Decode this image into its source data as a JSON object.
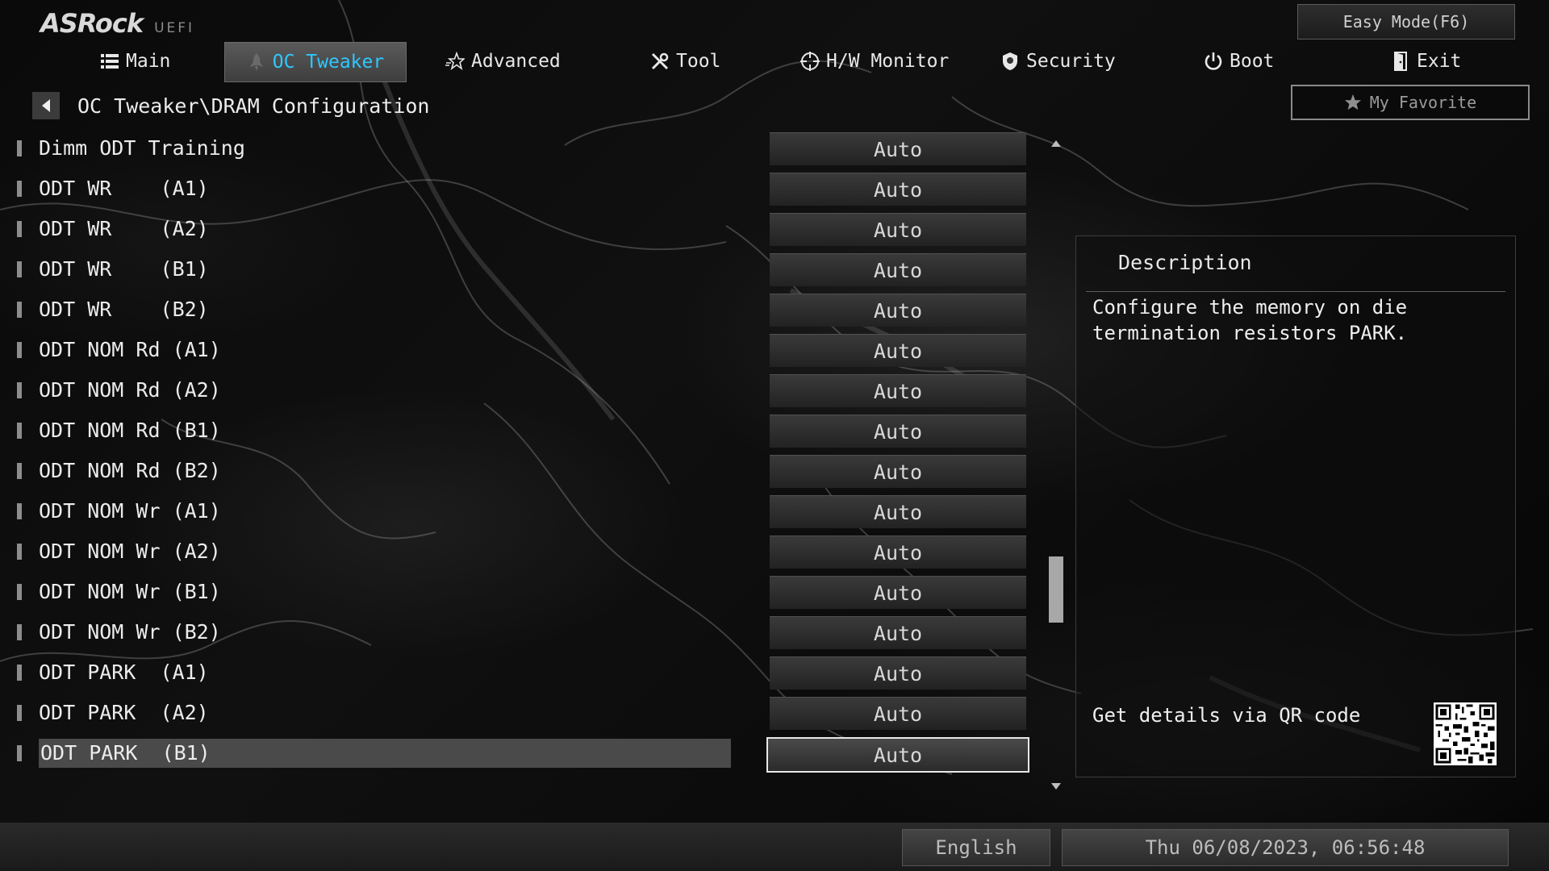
{
  "header": {
    "logo_main": "ASRock",
    "logo_sub": "UEFI",
    "easy_mode_label": "Easy Mode(F6)",
    "favorite_label": "My Favorite",
    "favorite_icon": "star-icon"
  },
  "nav": {
    "tabs": [
      {
        "label": "Main",
        "icon": "list-icon",
        "active": false
      },
      {
        "label": "OC Tweaker",
        "icon": "rocket-icon",
        "active": true
      },
      {
        "label": "Advanced",
        "icon": "star-icon",
        "active": false
      },
      {
        "label": "Tool",
        "icon": "tools-icon",
        "active": false
      },
      {
        "label": "H/W Monitor",
        "icon": "crosshair-icon",
        "active": false
      },
      {
        "label": "Security",
        "icon": "shield-icon",
        "active": false
      },
      {
        "label": "Boot",
        "icon": "power-icon",
        "active": false
      },
      {
        "label": "Exit",
        "icon": "exit-door-icon",
        "active": false
      }
    ],
    "active_color": "#2ec7ff"
  },
  "breadcrumb": {
    "path": "OC Tweaker\\DRAM Configuration"
  },
  "settings": [
    {
      "label": "Dimm ODT Training",
      "value": "Auto"
    },
    {
      "label": "ODT WR    (A1)",
      "value": "Auto"
    },
    {
      "label": "ODT WR    (A2)",
      "value": "Auto"
    },
    {
      "label": "ODT WR    (B1)",
      "value": "Auto"
    },
    {
      "label": "ODT WR    (B2)",
      "value": "Auto"
    },
    {
      "label": "ODT NOM Rd (A1)",
      "value": "Auto"
    },
    {
      "label": "ODT NOM Rd (A2)",
      "value": "Auto"
    },
    {
      "label": "ODT NOM Rd (B1)",
      "value": "Auto"
    },
    {
      "label": "ODT NOM Rd (B2)",
      "value": "Auto"
    },
    {
      "label": "ODT NOM Wr (A1)",
      "value": "Auto"
    },
    {
      "label": "ODT NOM Wr (A2)",
      "value": "Auto"
    },
    {
      "label": "ODT NOM Wr (B1)",
      "value": "Auto"
    },
    {
      "label": "ODT NOM Wr (B2)",
      "value": "Auto"
    },
    {
      "label": "ODT PARK  (A1)",
      "value": "Auto"
    },
    {
      "label": "ODT PARK  (A2)",
      "value": "Auto"
    },
    {
      "label": "ODT PARK  (B1)",
      "value": "Auto",
      "selected": true
    }
  ],
  "description": {
    "title": "Description",
    "body": "Configure the memory on die termination resistors PARK.",
    "qr_label": "Get details via QR code"
  },
  "footer": {
    "language": "English",
    "datetime": "Thu 06/08/2023, 06:56:48"
  }
}
